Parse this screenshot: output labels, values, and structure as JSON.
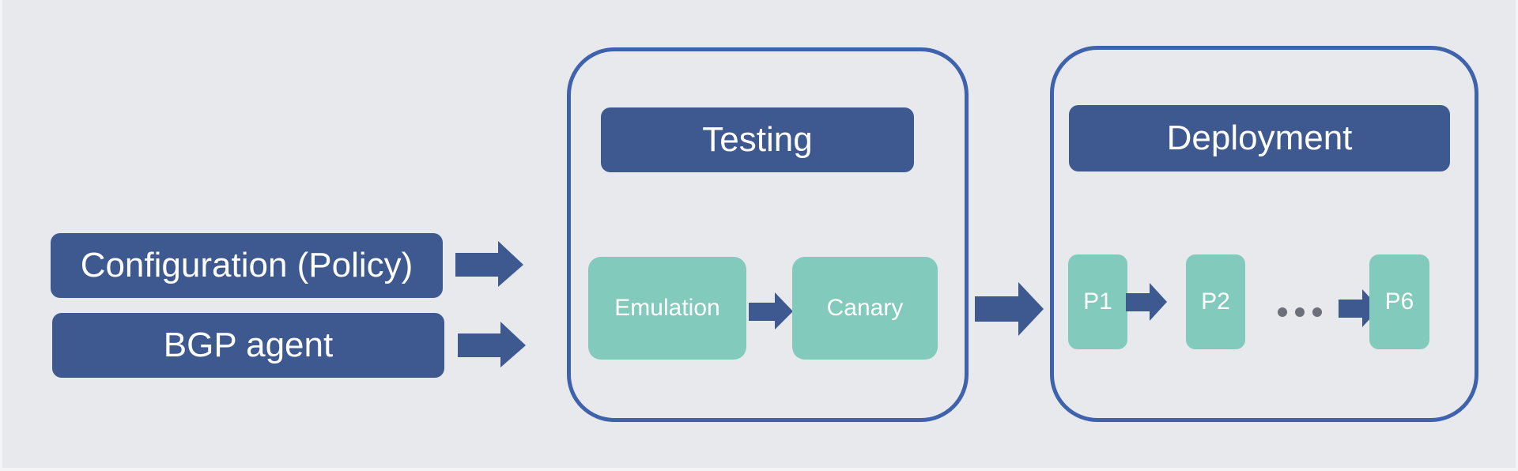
{
  "colors": {
    "background": "#e8e9ed",
    "header_fill": "#3e5890",
    "frame_border": "#3f62ac",
    "step_fill": "#82cabb",
    "arrow": "#3e5890",
    "ellipsis": "#6d7079"
  },
  "inputs": [
    {
      "label": "Configuration (Policy)"
    },
    {
      "label": "BGP agent"
    }
  ],
  "testing": {
    "title": "Testing",
    "steps": [
      {
        "label": "Emulation"
      },
      {
        "label": "Canary"
      }
    ]
  },
  "deployment": {
    "title": "Deployment",
    "phases": [
      {
        "label": "P1"
      },
      {
        "label": "P2"
      },
      {
        "label": "P6"
      }
    ],
    "ellipsis": "..."
  }
}
